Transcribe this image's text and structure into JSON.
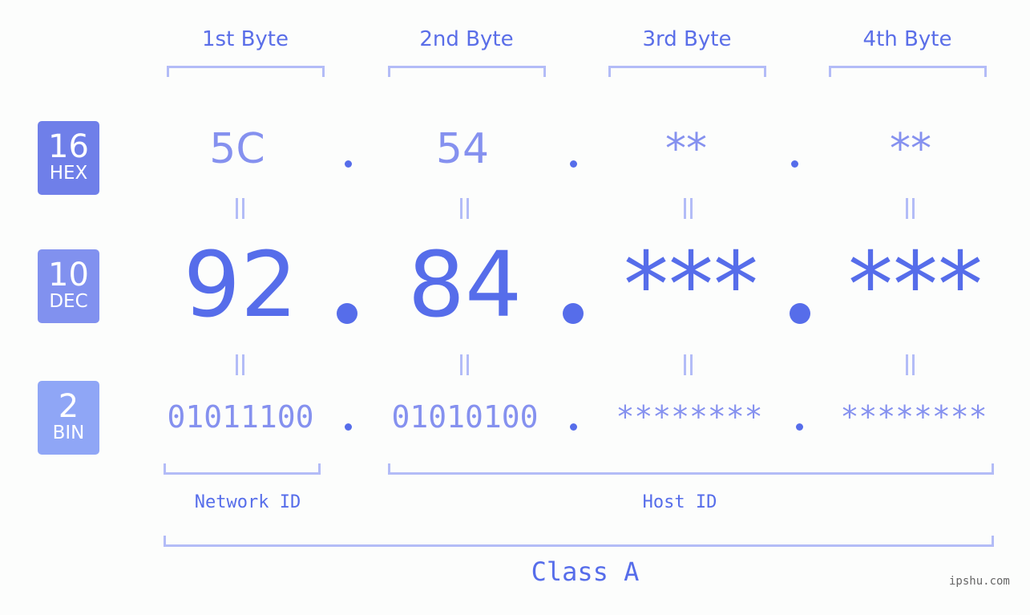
{
  "bytes_header": [
    "1st Byte",
    "2nd Byte",
    "3rd Byte",
    "4th Byte"
  ],
  "badges": [
    {
      "number": "16",
      "label": "HEX",
      "color": "#6f7fe9"
    },
    {
      "number": "10",
      "label": "DEC",
      "color": "#8191ef"
    },
    {
      "number": "2",
      "label": "BIN",
      "color": "#8fa6f6"
    }
  ],
  "hex": [
    "5C",
    "54",
    "**",
    "**"
  ],
  "dec": [
    "92",
    "84",
    "***",
    "***"
  ],
  "bin": [
    "01011100",
    "01010100",
    "********",
    "********"
  ],
  "separator": ".",
  "equals": "=",
  "network_label": "Network ID",
  "host_label": "Host ID",
  "class_label": "Class A",
  "watermark": "ipshu.com",
  "colors": {
    "accent": "#566dea",
    "light": "#8591ef",
    "bracket": "#b3bcf7"
  }
}
